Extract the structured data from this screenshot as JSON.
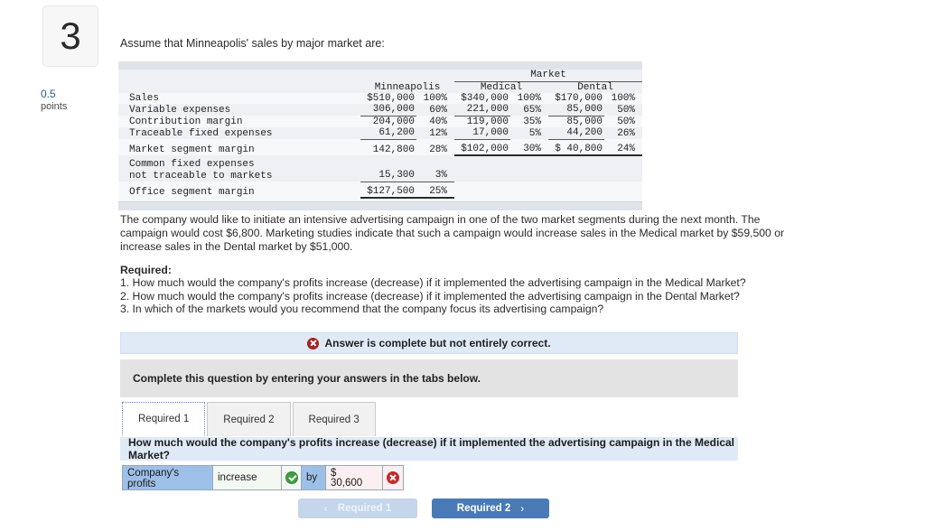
{
  "question": {
    "number": "3",
    "points_value": "0.5",
    "points_label": "points"
  },
  "intro_text": "Assume that Minneapolis' sales by major market are:",
  "financials": {
    "group_header": "Market",
    "columns": [
      "Minneapolis",
      "Medical",
      "Dental"
    ],
    "rows": [
      {
        "label": "Sales",
        "minneapolis": "$510,000",
        "minneapolis_pct": "100%",
        "medical": "$340,000",
        "medical_pct": "100%",
        "dental": "$170,000",
        "dental_pct": "100%"
      },
      {
        "label": "Variable expenses",
        "minneapolis": "306,000",
        "minneapolis_pct": "60%",
        "medical": "221,000",
        "medical_pct": "65%",
        "dental": "85,000",
        "dental_pct": "50%"
      },
      {
        "label": "Contribution margin",
        "minneapolis": "204,000",
        "minneapolis_pct": "40%",
        "medical": "119,000",
        "medical_pct": "35%",
        "dental": "85,000",
        "dental_pct": "50%"
      },
      {
        "label": "Traceable fixed expenses",
        "minneapolis": "61,200",
        "minneapolis_pct": "12%",
        "medical": "17,000",
        "medical_pct": "5%",
        "dental": "44,200",
        "dental_pct": "26%"
      },
      {
        "label": "Market segment margin",
        "minneapolis": "142,800",
        "minneapolis_pct": "28%",
        "medical": "$102,000",
        "medical_pct": "30%",
        "dental": "$ 40,800",
        "dental_pct": "24%"
      }
    ],
    "common_fixed": {
      "label_line1": "Common fixed expenses",
      "label_line2": "not traceable to markets",
      "minneapolis": "15,300",
      "minneapolis_pct": "3%"
    },
    "office_margin": {
      "label": "Office segment margin",
      "minneapolis": "$127,500",
      "minneapolis_pct": "25%"
    }
  },
  "body_paragraph": "The company would like to initiate an intensive advertising campaign in one of the two market segments during the next month. The campaign would cost $6,800. Marketing studies indicate that such a campaign would increase sales in the Medical market by $59,500 or increase sales in the Dental market by $51,000.",
  "required": {
    "heading": "Required:",
    "items": [
      "1. How much would the company's profits increase (decrease) if it implemented the advertising campaign in the Medical Market?",
      "2. How much would the company's profits increase (decrease) if it implemented the advertising campaign in the Dental Market?",
      "3. In which of the markets would you recommend that the company focus its advertising campaign?"
    ]
  },
  "status_banner": {
    "icon": "x-circle-icon",
    "text": "Answer is complete but not entirely correct."
  },
  "instruction_panel": {
    "text": "Complete this question by entering your answers in the tabs below."
  },
  "tabs": [
    {
      "label": "Required 1",
      "active": true
    },
    {
      "label": "Required 2",
      "active": false
    },
    {
      "label": "Required 3",
      "active": false
    }
  ],
  "question_prompt": "How much would the company's profits increase (decrease) if it implemented the advertising campaign in the Medical Market?",
  "answer_row": {
    "label": "Company's profits",
    "label_line1": "Company's",
    "label_line2": "profits",
    "select_value": "increase",
    "select_status": "correct",
    "by_label": "by",
    "amount_currency": "$",
    "amount_value": "30,600",
    "amount_status": "incorrect"
  },
  "navigation": {
    "prev_label": "Required 1",
    "prev_chevron": "‹",
    "next_label": "Required 2",
    "next_chevron": "›"
  },
  "colors": {
    "accent_blue": "#4a7ab5",
    "banner_blue": "#dfeaf6",
    "status_red": "#a52121",
    "status_green": "#3f9e44",
    "label_cell_blue": "#9dc0e8",
    "error_cell_pink": "#fbeff1"
  }
}
